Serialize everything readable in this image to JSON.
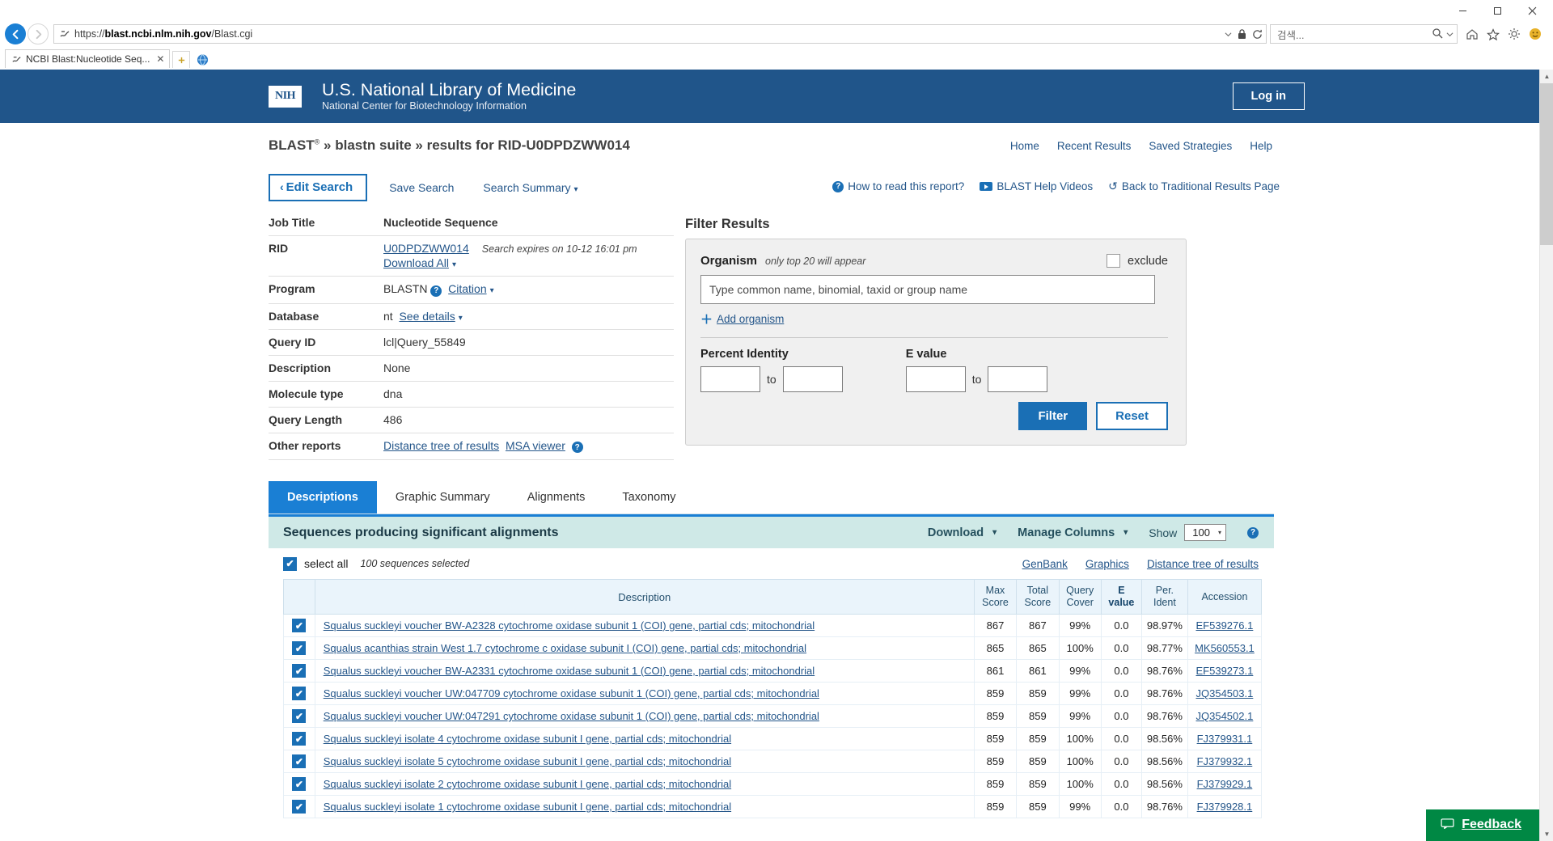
{
  "browser": {
    "url_prefix": "https://",
    "url_domain": "blast.ncbi.nlm.nih.gov",
    "url_path": "/Blast.cgi",
    "search_placeholder": "검색...",
    "tab_title": "NCBI Blast:Nucleotide Seq...",
    "tab_close": "✕",
    "newtab_label": "",
    "minimize": "─",
    "maximize": "❐",
    "close": "✕",
    "icons": {
      "back": "back-arrow-icon",
      "forward": "forward-arrow-icon",
      "site": "site-identity-icon",
      "dropdown": "address-dropdown-icon",
      "lock": "lock-icon",
      "refresh": "refresh-icon",
      "search": "search-icon",
      "home": "home-icon",
      "favorites": "star-icon",
      "tools": "gear-icon",
      "emoji": "smiley-icon"
    }
  },
  "nih": {
    "logo_text": "NIH",
    "title": "U.S. National Library of Medicine",
    "subtitle": "National Center for Biotechnology Information",
    "login_label": "Log in"
  },
  "blast_bar": {
    "crumb_main": "BLAST",
    "crumb_sup": "®",
    "crumb_rest": " » blastn suite » results for RID-U0DPDZWW014",
    "nav": [
      {
        "label": "Home"
      },
      {
        "label": "Recent Results"
      },
      {
        "label": "Saved Strategies"
      },
      {
        "label": "Help"
      }
    ]
  },
  "toolbar": {
    "edit_search": "Edit Search",
    "edit_search_chevron": "‹",
    "save_search": "Save Search",
    "search_summary": "Search Summary",
    "caret": "⌄"
  },
  "help_links": {
    "how_to_read": "How to read this report?",
    "help_videos": "BLAST Help Videos",
    "back_traditional": "Back to Traditional Results Page",
    "undo_glyph": "↺"
  },
  "job_info": {
    "rows": [
      {
        "key": "Job Title",
        "value": "Nucleotide Sequence",
        "bold": true
      },
      {
        "key": "RID",
        "value": "U0DPDZWW014",
        "extra": "Search expires on 10-12 16:01 pm"
      },
      {
        "key": "",
        "value": "Download All"
      },
      {
        "key": "Program",
        "value": "BLASTN",
        "extra": "Citation"
      },
      {
        "key": "Database",
        "value": "nt",
        "extra": "See details"
      },
      {
        "key": "Query ID",
        "value": "lcl|Query_55849"
      },
      {
        "key": "Description",
        "value": "None"
      },
      {
        "key": "Molecule type",
        "value": "dna"
      },
      {
        "key": "Query Length",
        "value": "486"
      },
      {
        "key": "Other reports",
        "value": "Distance tree of results",
        "extra": "MSA viewer"
      }
    ],
    "labels": {
      "job_title": "Job Title",
      "rid": "RID",
      "program": "Program",
      "database": "Database",
      "query_id": "Query ID",
      "description": "Description",
      "molecule_type": "Molecule type",
      "query_length": "Query Length",
      "other_reports": "Other reports"
    },
    "values": {
      "job_title": "Nucleotide Sequence",
      "rid": "U0DPDZWW014",
      "expires": "Search expires on 10-12 16:01 pm",
      "download_all": "Download All",
      "program": "BLASTN",
      "citation": "Citation",
      "database": "nt",
      "see_details": "See details",
      "query_id": "lcl|Query_55849",
      "description": "None",
      "molecule_type": "dna",
      "query_length": "486",
      "distance_tree": "Distance tree of results",
      "msa_viewer": "MSA viewer"
    }
  },
  "filter": {
    "title": "Filter Results",
    "organism_label": "Organism",
    "organism_hint": "only top 20 will appear",
    "exclude_label": "exclude",
    "organism_placeholder": "Type common  name, binomial, taxid or group  name",
    "add_organism": "Add organism",
    "plus": "＋",
    "percent_identity_label": "Percent Identity",
    "evalue_label": "E value",
    "to_label": "to",
    "pid_from": "",
    "pid_to": "",
    "ev_from": "",
    "ev_to": "",
    "filter_button": "Filter",
    "reset_button": "Reset"
  },
  "tabs": [
    {
      "label": "Descriptions",
      "active": true
    },
    {
      "label": "Graphic Summary",
      "active": false
    },
    {
      "label": "Alignments",
      "active": false
    },
    {
      "label": "Taxonomy",
      "active": false
    }
  ],
  "results": {
    "heading": "Sequences producing significant alignments",
    "download_label": "Download",
    "manage_columns_label": "Manage Columns",
    "show_label": "Show",
    "show_value": "100",
    "select_all_label": "select all",
    "selected_count": "100 sequences selected",
    "links": [
      {
        "label": "GenBank"
      },
      {
        "label": "Graphics"
      },
      {
        "label": "Distance tree of results"
      }
    ],
    "columns": [
      {
        "label": "Description"
      },
      {
        "label": "Max\nScore"
      },
      {
        "label": "Total\nScore"
      },
      {
        "label": "Query\nCover"
      },
      {
        "label": "E\nvalue"
      },
      {
        "label": "Per.\nIdent"
      },
      {
        "label": "Accession"
      }
    ],
    "column_labels": {
      "description": "Description",
      "max_score_l1": "Max",
      "max_score_l2": "Score",
      "total_score_l1": "Total",
      "total_score_l2": "Score",
      "query_cover_l1": "Query",
      "query_cover_l2": "Cover",
      "evalue_l1": "E",
      "evalue_l2": "value",
      "per_ident_l1": "Per.",
      "per_ident_l2": "Ident",
      "accession": "Accession"
    },
    "rows": [
      {
        "checked": true,
        "description": "Squalus suckleyi voucher BW-A2328 cytochrome oxidase subunit 1 (COI) gene, partial cds; mitochondrial",
        "max_score": "867",
        "total_score": "867",
        "query_cover": "99%",
        "e_value": "0.0",
        "per_ident": "98.97%",
        "accession": "EF539276.1"
      },
      {
        "checked": true,
        "description": "Squalus acanthias strain West 1.7 cytochrome c oxidase subunit I (COI) gene, partial cds; mitochondrial",
        "max_score": "865",
        "total_score": "865",
        "query_cover": "100%",
        "e_value": "0.0",
        "per_ident": "98.77%",
        "accession": "MK560553.1"
      },
      {
        "checked": true,
        "description": "Squalus suckleyi voucher BW-A2331 cytochrome oxidase subunit 1 (COI) gene, partial cds; mitochondrial",
        "max_score": "861",
        "total_score": "861",
        "query_cover": "99%",
        "e_value": "0.0",
        "per_ident": "98.76%",
        "accession": "EF539273.1"
      },
      {
        "checked": true,
        "description": "Squalus suckleyi voucher UW:047709 cytochrome oxidase subunit 1 (COI) gene, partial cds; mitochondrial",
        "max_score": "859",
        "total_score": "859",
        "query_cover": "99%",
        "e_value": "0.0",
        "per_ident": "98.76%",
        "accession": "JQ354503.1"
      },
      {
        "checked": true,
        "description": "Squalus suckleyi voucher UW:047291 cytochrome oxidase subunit 1 (COI) gene, partial cds; mitochondrial",
        "max_score": "859",
        "total_score": "859",
        "query_cover": "99%",
        "e_value": "0.0",
        "per_ident": "98.76%",
        "accession": "JQ354502.1"
      },
      {
        "checked": true,
        "description": "Squalus suckleyi isolate 4 cytochrome oxidase subunit I gene, partial cds; mitochondrial",
        "max_score": "859",
        "total_score": "859",
        "query_cover": "100%",
        "e_value": "0.0",
        "per_ident": "98.56%",
        "accession": "FJ379931.1"
      },
      {
        "checked": true,
        "description": "Squalus suckleyi isolate 5 cytochrome oxidase subunit I gene, partial cds; mitochondrial",
        "max_score": "859",
        "total_score": "859",
        "query_cover": "100%",
        "e_value": "0.0",
        "per_ident": "98.56%",
        "accession": "FJ379932.1"
      },
      {
        "checked": true,
        "description": "Squalus suckleyi isolate 2 cytochrome oxidase subunit I gene, partial cds; mitochondrial",
        "max_score": "859",
        "total_score": "859",
        "query_cover": "100%",
        "e_value": "0.0",
        "per_ident": "98.56%",
        "accession": "FJ379929.1"
      },
      {
        "checked": true,
        "description": "Squalus suckleyi isolate 1 cytochrome oxidase subunit I gene, partial cds; mitochondrial",
        "max_score": "859",
        "total_score": "859",
        "query_cover": "99%",
        "e_value": "0.0",
        "per_ident": "98.76%",
        "accession": "FJ379928.1"
      }
    ]
  },
  "feedback": {
    "label": "Feedback",
    "icon": "speech-bubble-icon"
  },
  "colors": {
    "nih_blue": "#20558a",
    "accent_blue": "#1a7fd4",
    "link_blue": "#24568a",
    "results_header": "#cfe9e7",
    "feedback_green": "#008844"
  }
}
